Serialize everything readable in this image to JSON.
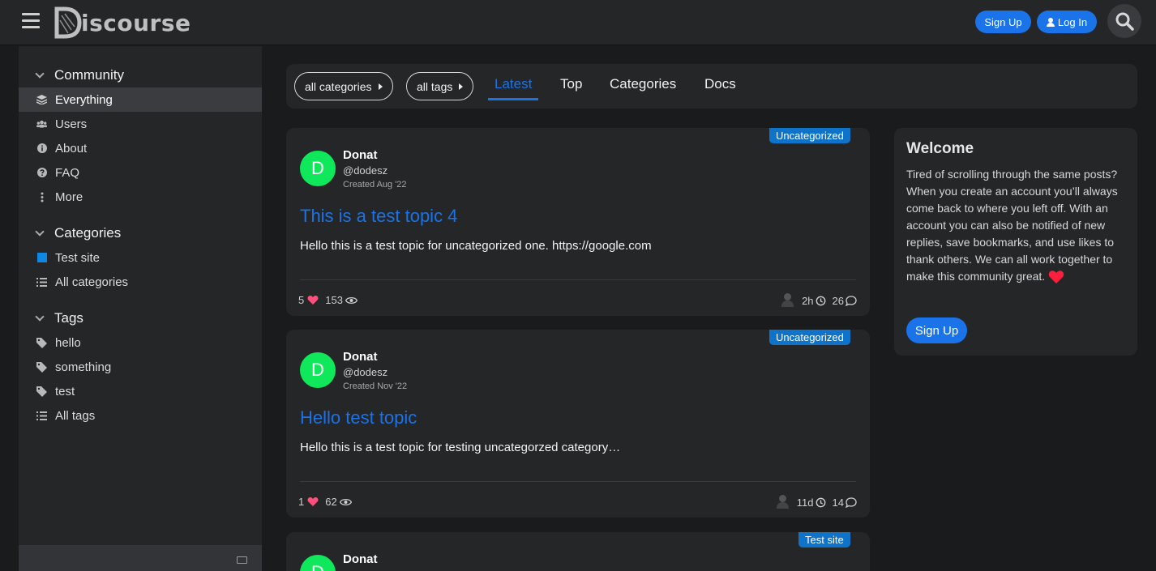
{
  "header": {
    "logo_text": "iscourse",
    "signup_label": "Sign Up",
    "login_label": "Log In"
  },
  "sidebar": {
    "community": {
      "title": "Community",
      "items": [
        {
          "label": "Everything",
          "icon": "layers-icon"
        },
        {
          "label": "Users",
          "icon": "users-icon"
        },
        {
          "label": "About",
          "icon": "info-icon"
        },
        {
          "label": "FAQ",
          "icon": "question-icon"
        },
        {
          "label": "More",
          "icon": "more-vertical-icon"
        }
      ]
    },
    "categories": {
      "title": "Categories",
      "items": [
        {
          "label": "Test site",
          "icon": "category-square-icon"
        },
        {
          "label": "All categories",
          "icon": "list-icon"
        }
      ]
    },
    "tags": {
      "title": "Tags",
      "items": [
        {
          "label": "hello",
          "icon": "tag-icon"
        },
        {
          "label": "something",
          "icon": "tag-icon"
        },
        {
          "label": "test",
          "icon": "tag-icon"
        },
        {
          "label": "All tags",
          "icon": "list-icon"
        }
      ]
    }
  },
  "nav": {
    "categories_filter": "all categories",
    "tags_filter": "all tags",
    "tabs": [
      "Latest",
      "Top",
      "Categories",
      "Docs"
    ],
    "active_tab": "Latest"
  },
  "topics": [
    {
      "category": "Uncategorized",
      "avatar_letter": "D",
      "author_name": "Donat",
      "author_handle": "@dodesz",
      "created": "Created Aug '22",
      "title": "This is a test topic 4",
      "excerpt": "Hello this is a test topic for uncategorized one. https://google.com",
      "likes": "5",
      "views": "153",
      "last_activity": "2h",
      "replies": "26"
    },
    {
      "category": "Uncategorized",
      "avatar_letter": "D",
      "author_name": "Donat",
      "author_handle": "@dodesz",
      "created": "Created Nov '22",
      "title": "Hello test topic",
      "excerpt": "Hello this is a test topic for testing uncategorzed category…",
      "likes": "1",
      "views": "62",
      "last_activity": "11d",
      "replies": "14"
    },
    {
      "category": "Test site",
      "avatar_letter": "D",
      "author_name": "Donat"
    }
  ],
  "welcome": {
    "title": "Welcome",
    "body": "Tired of scrolling through the same posts? When you create an account you’ll always come back to where you left off. With an account you can also be notified of new replies, save bookmarks, and use likes to thank others. We can all work together to make this community great.",
    "signup_label": "Sign Up"
  },
  "colors": {
    "accent": "#1a73e8",
    "avatar": "#0fe85a",
    "category_badge": "#0e73c9",
    "heart": "#ff2a55"
  }
}
